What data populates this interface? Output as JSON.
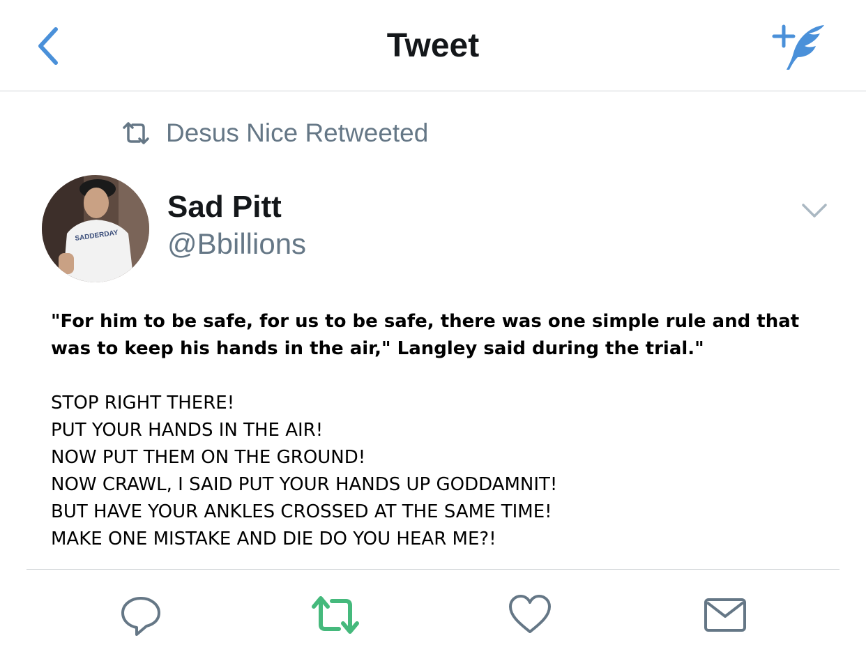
{
  "header": {
    "title": "Tweet",
    "back_icon": "chevron-left-icon",
    "compose_icon": "compose-tweet-icon",
    "accent": "#4a90d9"
  },
  "retweet_context": {
    "icon": "retweet-icon",
    "text": "Desus Nice Retweeted"
  },
  "author": {
    "name": "Sad Pitt",
    "handle": "@Bbillions",
    "avatar_shirt_text": "SADDERDAY"
  },
  "tweet": {
    "lead": "\"For him to be safe, for us to be safe, there was one simple rule and that was to keep his hands in the air,\" Langley said during the trial.\"",
    "lines": [
      "STOP RIGHT THERE!",
      "PUT YOUR HANDS IN THE AIR!",
      "NOW PUT THEM ON THE GROUND!",
      "NOW CRAWL, I SAID PUT YOUR HANDS UP GODDAMNIT!",
      "BUT HAVE YOUR ANKLES CROSSED AT THE SAME TIME!",
      "MAKE ONE MISTAKE AND DIE DO YOU HEAR ME?!"
    ]
  },
  "actions": {
    "reply_icon": "reply-icon",
    "retweet_icon": "retweet-icon",
    "retweet_color": "#45b97c",
    "like_icon": "heart-icon",
    "dm_icon": "envelope-icon",
    "icon_color": "#657786"
  }
}
